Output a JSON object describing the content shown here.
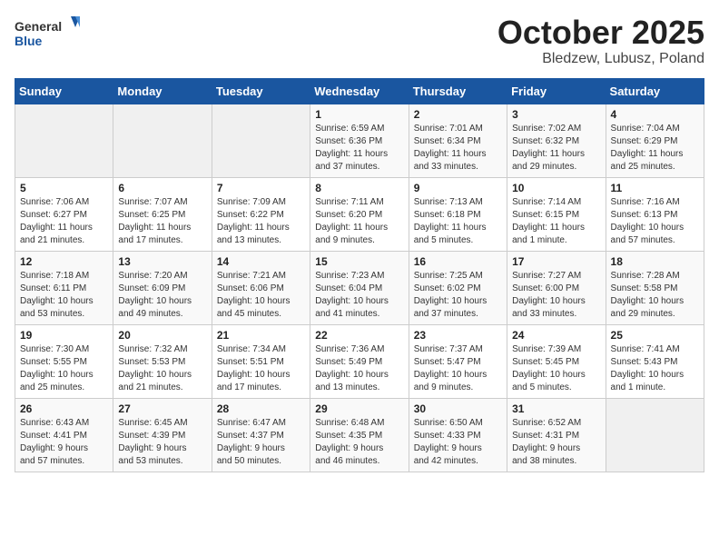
{
  "header": {
    "logo_general": "General",
    "logo_blue": "Blue",
    "month_title": "October 2025",
    "location": "Bledzew, Lubusz, Poland"
  },
  "days_of_week": [
    "Sunday",
    "Monday",
    "Tuesday",
    "Wednesday",
    "Thursday",
    "Friday",
    "Saturday"
  ],
  "weeks": [
    [
      {
        "day": "",
        "info": ""
      },
      {
        "day": "",
        "info": ""
      },
      {
        "day": "",
        "info": ""
      },
      {
        "day": "1",
        "info": "Sunrise: 6:59 AM\nSunset: 6:36 PM\nDaylight: 11 hours\nand 37 minutes."
      },
      {
        "day": "2",
        "info": "Sunrise: 7:01 AM\nSunset: 6:34 PM\nDaylight: 11 hours\nand 33 minutes."
      },
      {
        "day": "3",
        "info": "Sunrise: 7:02 AM\nSunset: 6:32 PM\nDaylight: 11 hours\nand 29 minutes."
      },
      {
        "day": "4",
        "info": "Sunrise: 7:04 AM\nSunset: 6:29 PM\nDaylight: 11 hours\nand 25 minutes."
      }
    ],
    [
      {
        "day": "5",
        "info": "Sunrise: 7:06 AM\nSunset: 6:27 PM\nDaylight: 11 hours\nand 21 minutes."
      },
      {
        "day": "6",
        "info": "Sunrise: 7:07 AM\nSunset: 6:25 PM\nDaylight: 11 hours\nand 17 minutes."
      },
      {
        "day": "7",
        "info": "Sunrise: 7:09 AM\nSunset: 6:22 PM\nDaylight: 11 hours\nand 13 minutes."
      },
      {
        "day": "8",
        "info": "Sunrise: 7:11 AM\nSunset: 6:20 PM\nDaylight: 11 hours\nand 9 minutes."
      },
      {
        "day": "9",
        "info": "Sunrise: 7:13 AM\nSunset: 6:18 PM\nDaylight: 11 hours\nand 5 minutes."
      },
      {
        "day": "10",
        "info": "Sunrise: 7:14 AM\nSunset: 6:15 PM\nDaylight: 11 hours\nand 1 minute."
      },
      {
        "day": "11",
        "info": "Sunrise: 7:16 AM\nSunset: 6:13 PM\nDaylight: 10 hours\nand 57 minutes."
      }
    ],
    [
      {
        "day": "12",
        "info": "Sunrise: 7:18 AM\nSunset: 6:11 PM\nDaylight: 10 hours\nand 53 minutes."
      },
      {
        "day": "13",
        "info": "Sunrise: 7:20 AM\nSunset: 6:09 PM\nDaylight: 10 hours\nand 49 minutes."
      },
      {
        "day": "14",
        "info": "Sunrise: 7:21 AM\nSunset: 6:06 PM\nDaylight: 10 hours\nand 45 minutes."
      },
      {
        "day": "15",
        "info": "Sunrise: 7:23 AM\nSunset: 6:04 PM\nDaylight: 10 hours\nand 41 minutes."
      },
      {
        "day": "16",
        "info": "Sunrise: 7:25 AM\nSunset: 6:02 PM\nDaylight: 10 hours\nand 37 minutes."
      },
      {
        "day": "17",
        "info": "Sunrise: 7:27 AM\nSunset: 6:00 PM\nDaylight: 10 hours\nand 33 minutes."
      },
      {
        "day": "18",
        "info": "Sunrise: 7:28 AM\nSunset: 5:58 PM\nDaylight: 10 hours\nand 29 minutes."
      }
    ],
    [
      {
        "day": "19",
        "info": "Sunrise: 7:30 AM\nSunset: 5:55 PM\nDaylight: 10 hours\nand 25 minutes."
      },
      {
        "day": "20",
        "info": "Sunrise: 7:32 AM\nSunset: 5:53 PM\nDaylight: 10 hours\nand 21 minutes."
      },
      {
        "day": "21",
        "info": "Sunrise: 7:34 AM\nSunset: 5:51 PM\nDaylight: 10 hours\nand 17 minutes."
      },
      {
        "day": "22",
        "info": "Sunrise: 7:36 AM\nSunset: 5:49 PM\nDaylight: 10 hours\nand 13 minutes."
      },
      {
        "day": "23",
        "info": "Sunrise: 7:37 AM\nSunset: 5:47 PM\nDaylight: 10 hours\nand 9 minutes."
      },
      {
        "day": "24",
        "info": "Sunrise: 7:39 AM\nSunset: 5:45 PM\nDaylight: 10 hours\nand 5 minutes."
      },
      {
        "day": "25",
        "info": "Sunrise: 7:41 AM\nSunset: 5:43 PM\nDaylight: 10 hours\nand 1 minute."
      }
    ],
    [
      {
        "day": "26",
        "info": "Sunrise: 6:43 AM\nSunset: 4:41 PM\nDaylight: 9 hours\nand 57 minutes."
      },
      {
        "day": "27",
        "info": "Sunrise: 6:45 AM\nSunset: 4:39 PM\nDaylight: 9 hours\nand 53 minutes."
      },
      {
        "day": "28",
        "info": "Sunrise: 6:47 AM\nSunset: 4:37 PM\nDaylight: 9 hours\nand 50 minutes."
      },
      {
        "day": "29",
        "info": "Sunrise: 6:48 AM\nSunset: 4:35 PM\nDaylight: 9 hours\nand 46 minutes."
      },
      {
        "day": "30",
        "info": "Sunrise: 6:50 AM\nSunset: 4:33 PM\nDaylight: 9 hours\nand 42 minutes."
      },
      {
        "day": "31",
        "info": "Sunrise: 6:52 AM\nSunset: 4:31 PM\nDaylight: 9 hours\nand 38 minutes."
      },
      {
        "day": "",
        "info": ""
      }
    ]
  ]
}
